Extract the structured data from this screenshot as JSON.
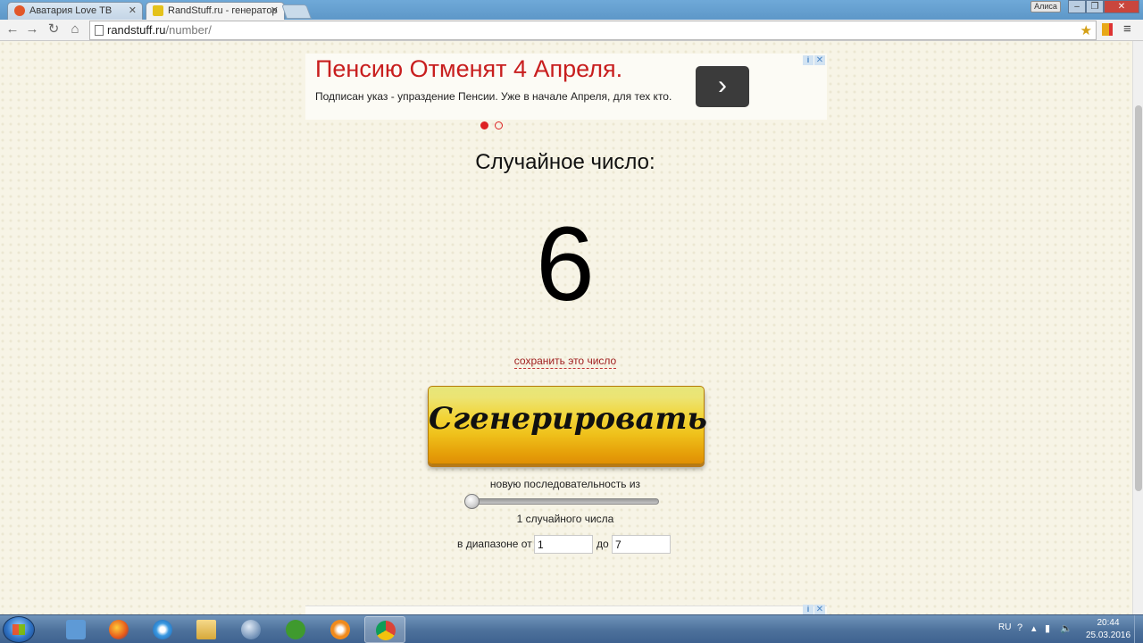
{
  "browser": {
    "tabs": [
      {
        "title": "Аватария Love ТВ",
        "active": false
      },
      {
        "title": "RandStuff.ru - генератор",
        "active": true
      }
    ],
    "user": "Алиса",
    "url_host": "randstuff.ru",
    "url_path": "/number/"
  },
  "ad": {
    "title": "Пенсию Отменят 4 Апреля.",
    "text": "Подписан указ - упраздение Пенсии. Уже в начале Апреля, для тех кто."
  },
  "page": {
    "heading": "Случайное число:",
    "result": "6",
    "save_link": "сохранить это число",
    "generate_button": "Сгенерировать",
    "sequence_label": "новую последовательность из",
    "count_label": "1 случайного числа",
    "range_from_label": "в диапазоне от",
    "range_from_value": "1",
    "range_to_label": "до",
    "range_to_value": "7",
    "slider_value": 1
  },
  "taskbar": {
    "language": "RU",
    "time": "20:44",
    "date": "25.03.2016"
  }
}
